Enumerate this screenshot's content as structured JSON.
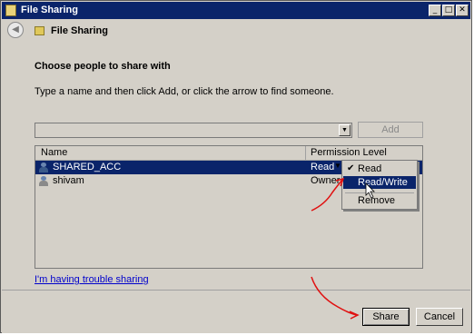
{
  "window": {
    "title": "File Sharing",
    "controls": [
      "minimize",
      "maximize",
      "close"
    ]
  },
  "nav": {
    "back_icon": "back-arrow-icon",
    "title": "File Sharing"
  },
  "content": {
    "heading": "Choose people to share with",
    "instruction": "Type a name and then click Add, or click the arrow to find someone.",
    "name_input_value": "",
    "add_label": "Add",
    "columns": [
      "Name",
      "Permission Level"
    ],
    "rows": [
      {
        "name": "SHARED_ACC",
        "permission": "Read",
        "selected": true
      },
      {
        "name": "shivam",
        "permission": "Owner",
        "selected": false
      }
    ],
    "permission_menu": {
      "items": [
        "Read",
        "Read/Write",
        "Remove"
      ],
      "checked": "Read",
      "highlighted": "Read/Write"
    },
    "trouble_link": "I'm having trouble sharing"
  },
  "footer": {
    "share_label": "Share",
    "cancel_label": "Cancel"
  },
  "colors": {
    "titlebar": "#0a246a",
    "selection": "#0a246a",
    "annotation": "#e01010",
    "link": "#0000cc"
  }
}
